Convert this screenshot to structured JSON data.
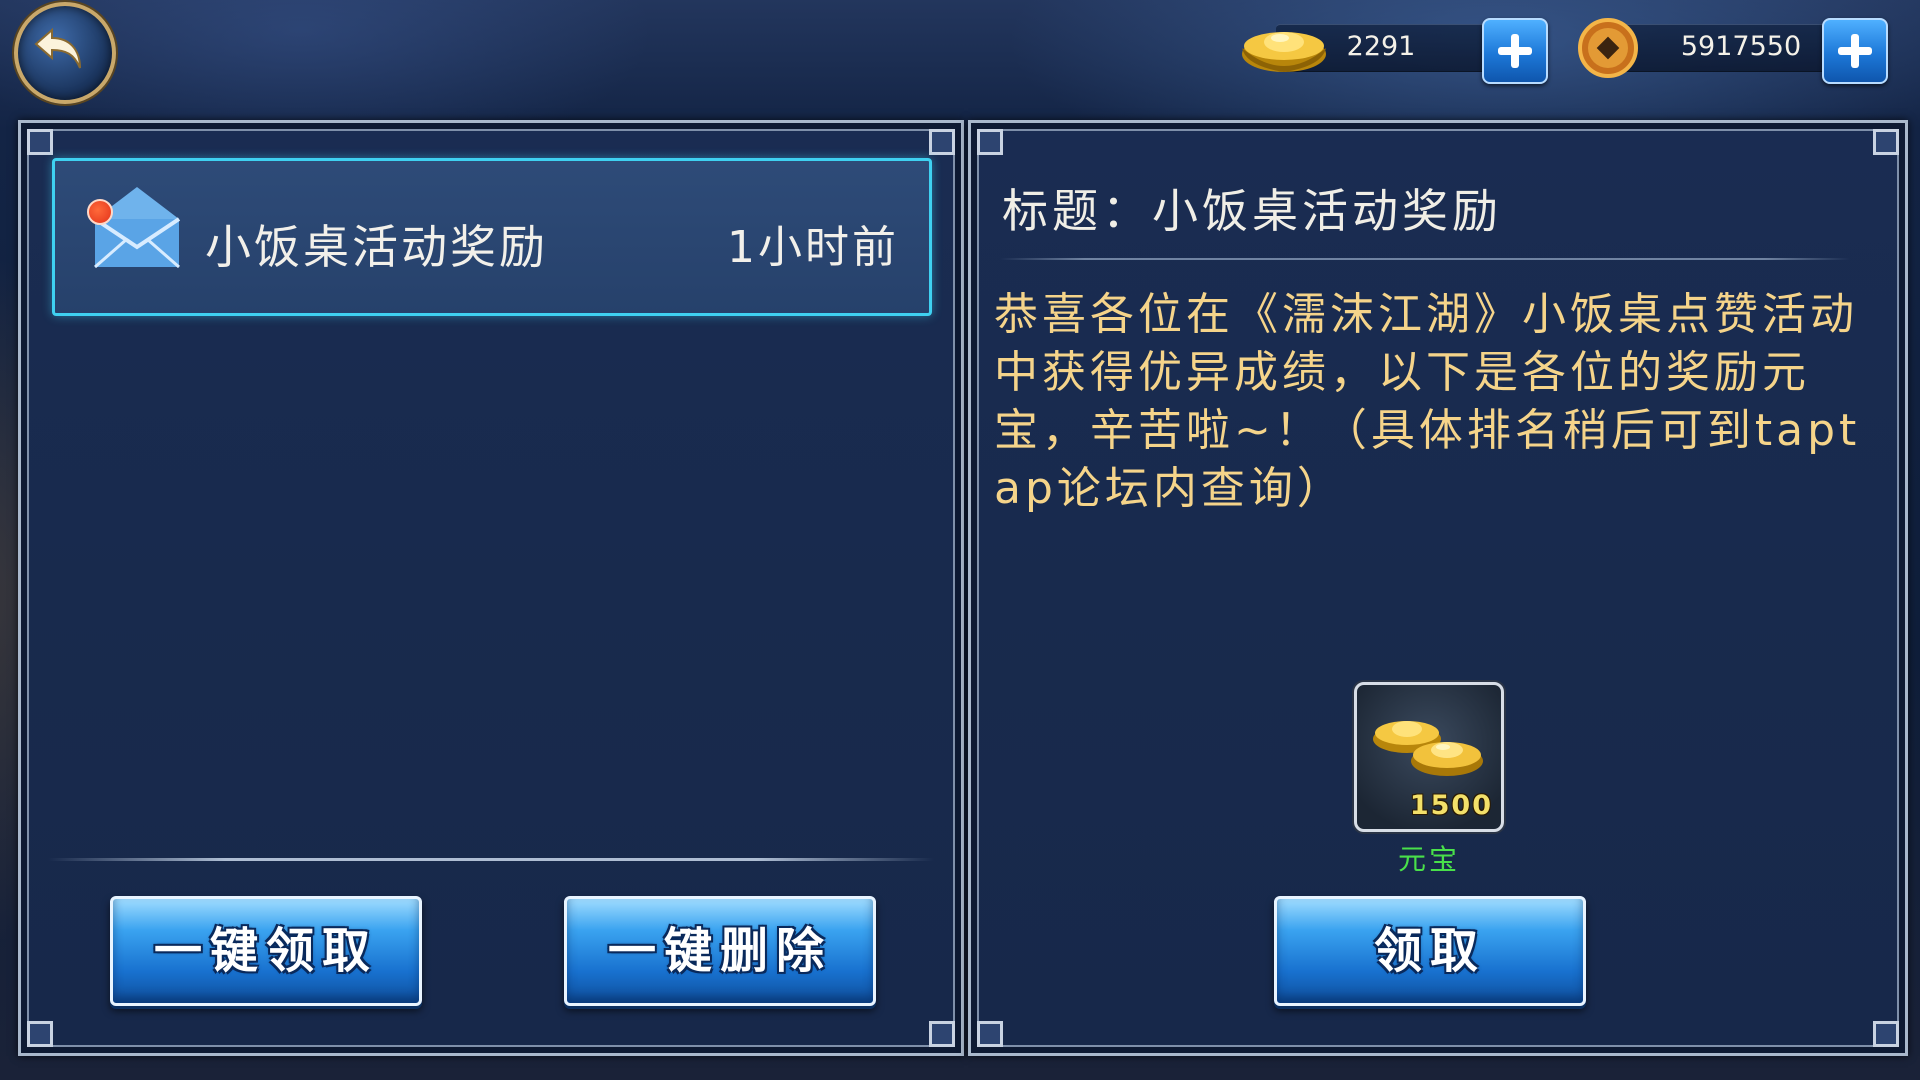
{
  "currencies": {
    "ingot": {
      "icon": "gold-ingot-icon",
      "amount": "2291"
    },
    "coin": {
      "icon": "copper-coin-icon",
      "amount": "5917550"
    }
  },
  "mail_list": {
    "items": [
      {
        "subject": "小饭桌活动奖励",
        "time": "1小时前",
        "unread": true
      }
    ]
  },
  "actions": {
    "claim_all": "一键领取",
    "delete_all": "一键删除"
  },
  "detail": {
    "title": "标题：小饭桌活动奖励",
    "body": "恭喜各位在《濡沫江湖》小饭桌点赞活动中获得优异成绩，以下是各位的奖励元宝，辛苦啦~！（具体排名稍后可到taptap论坛内查询）",
    "reward": {
      "icon": "gold-ingot-icon",
      "quantity": "1500",
      "name": "元宝",
      "name_color": "#49e04a"
    },
    "claim": "领取"
  },
  "colors": {
    "highlight_border": "#3fd1f1",
    "body_text": "#f5d48a",
    "button_blue": "#1871cf"
  }
}
